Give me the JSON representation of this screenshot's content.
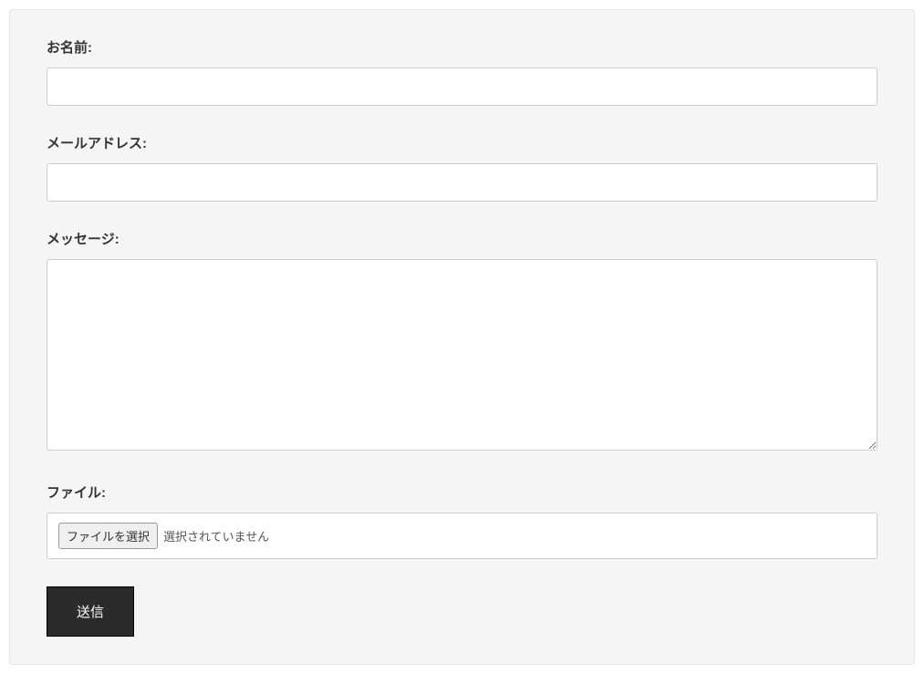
{
  "form": {
    "name": {
      "label": "お名前:",
      "value": ""
    },
    "email": {
      "label": "メールアドレス:",
      "value": ""
    },
    "message": {
      "label": "メッセージ:",
      "value": ""
    },
    "file": {
      "label": "ファイル:",
      "button_text": "ファイルを選択",
      "status_text": "選択されていません"
    },
    "submit": {
      "label": "送信"
    }
  }
}
